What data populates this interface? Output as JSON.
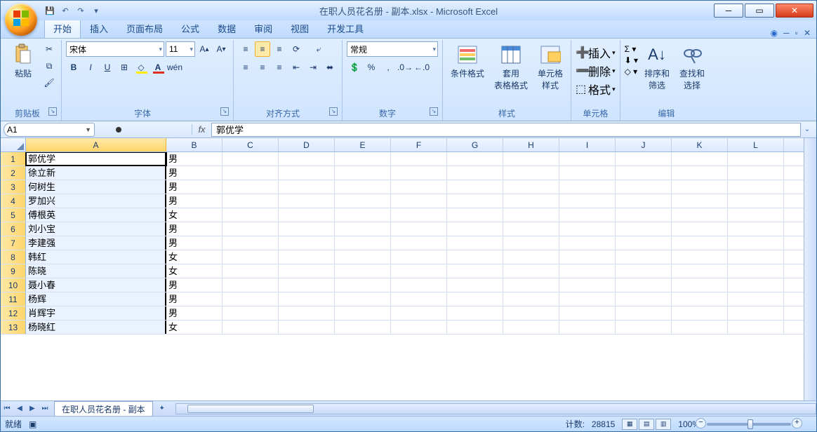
{
  "window": {
    "title": "在职人员花名册 - 副本.xlsx - Microsoft Excel"
  },
  "qat": {
    "save": "save-icon",
    "undo": "undo-icon",
    "redo": "redo-icon"
  },
  "tabs": {
    "items": [
      "开始",
      "插入",
      "页面布局",
      "公式",
      "数据",
      "审阅",
      "视图",
      "开发工具"
    ],
    "active": 0
  },
  "ribbon": {
    "clipboard": {
      "paste": "粘贴",
      "title": "剪贴板"
    },
    "font": {
      "name": "宋体",
      "size": "11",
      "bold": "B",
      "italic": "I",
      "underline": "U",
      "title": "字体"
    },
    "alignment": {
      "title": "对齐方式"
    },
    "number": {
      "format": "常规",
      "title": "数字"
    },
    "styles": {
      "cond": "条件格式",
      "table": "套用\n表格格式",
      "cell": "单元格\n样式",
      "title": "样式"
    },
    "cells": {
      "insert": "插入",
      "delete": "删除",
      "format": "格式",
      "title": "单元格"
    },
    "editing": {
      "sort": "排序和\n筛选",
      "find": "查找和\n选择",
      "title": "编辑"
    }
  },
  "namebox": {
    "ref": "A1",
    "fx": "fx",
    "formula": "郭优学"
  },
  "columns": [
    "A",
    "B",
    "C",
    "D",
    "E",
    "F",
    "G",
    "H",
    "I",
    "J",
    "K",
    "L"
  ],
  "col_widths": {
    "A": 200,
    "B": 80,
    "other": 80
  },
  "selected_col": "A",
  "active_cell": "A1",
  "rows": [
    {
      "n": 1,
      "A": "郭优学",
      "B": "男"
    },
    {
      "n": 2,
      "A": "徐立新",
      "B": "男"
    },
    {
      "n": 3,
      "A": "何树生",
      "B": "男"
    },
    {
      "n": 4,
      "A": "罗加兴",
      "B": "男"
    },
    {
      "n": 5,
      "A": "傅根英",
      "B": "女"
    },
    {
      "n": 6,
      "A": "刘小宝",
      "B": "男"
    },
    {
      "n": 7,
      "A": "李建强",
      "B": "男"
    },
    {
      "n": 8,
      "A": "韩红",
      "B": "女"
    },
    {
      "n": 9,
      "A": "陈晓",
      "B": "女"
    },
    {
      "n": 10,
      "A": "聂小春",
      "B": "男"
    },
    {
      "n": 11,
      "A": "杨辉",
      "B": "男"
    },
    {
      "n": 12,
      "A": "肖辉宇",
      "B": "男"
    },
    {
      "n": 13,
      "A": "杨晓红",
      "B": "女"
    }
  ],
  "sheet_tab": "在职人员花名册 - 副本",
  "status": {
    "ready": "就绪",
    "count_label": "计数:",
    "count": "28815",
    "zoom": "100%"
  }
}
